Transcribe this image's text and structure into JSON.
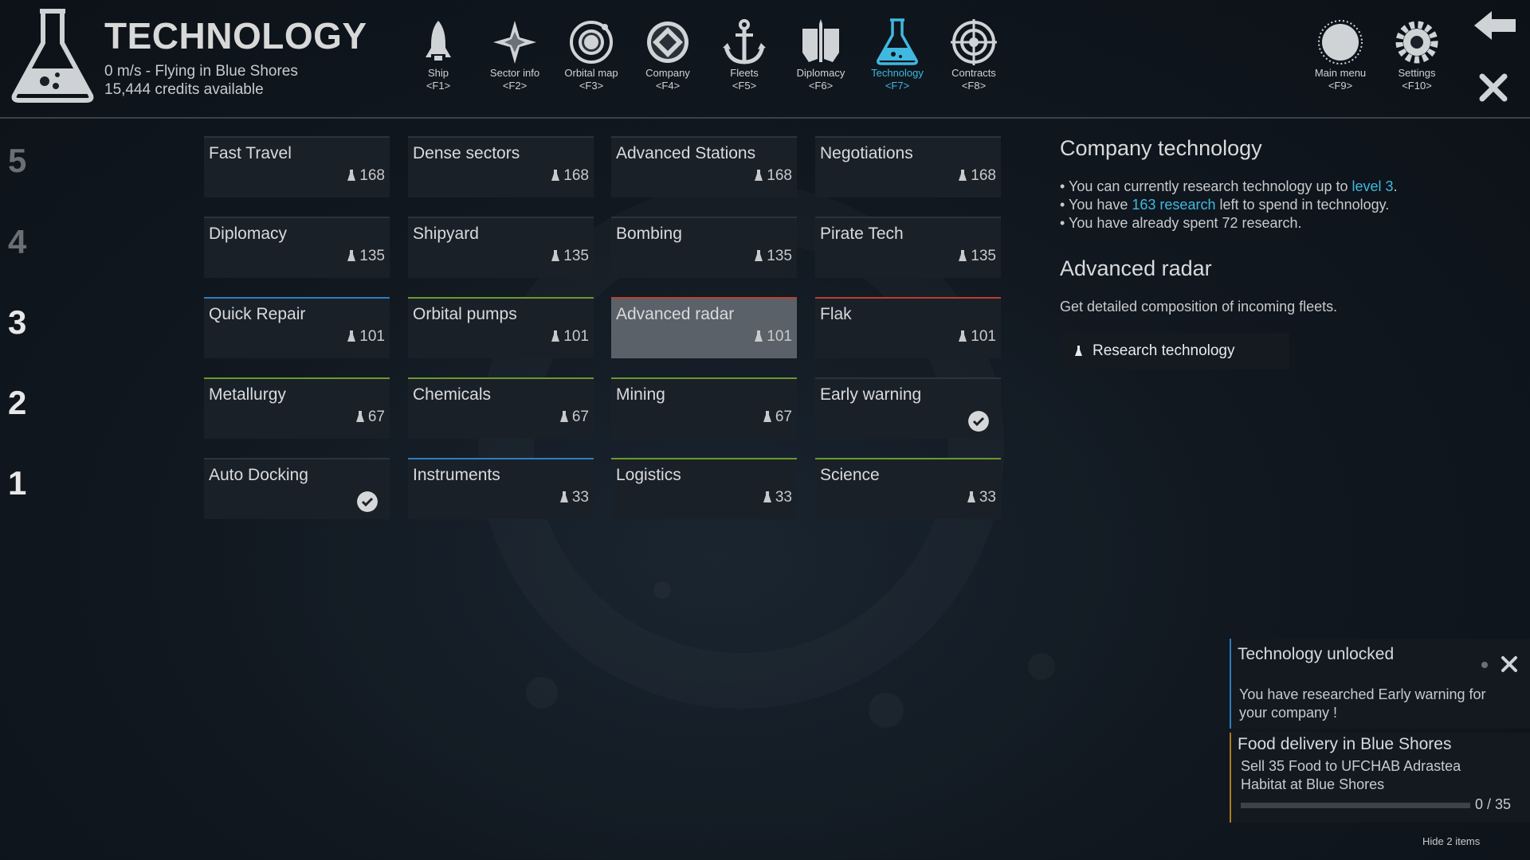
{
  "header": {
    "title": "TECHNOLOGY",
    "status_line": "0 m/s - Flying in Blue Shores",
    "credits_line": "15,444 credits available"
  },
  "nav": [
    {
      "label": "Ship",
      "key": "<F1>",
      "icon": "rocket-icon"
    },
    {
      "label": "Sector info",
      "key": "<F2>",
      "icon": "compass-star-icon"
    },
    {
      "label": "Orbital map",
      "key": "<F3>",
      "icon": "orbit-icon"
    },
    {
      "label": "Company",
      "key": "<F4>",
      "icon": "company-emblem-icon"
    },
    {
      "label": "Fleets",
      "key": "<F5>",
      "icon": "anchor-icon"
    },
    {
      "label": "Diplomacy",
      "key": "<F6>",
      "icon": "diplomacy-icon"
    },
    {
      "label": "Technology",
      "key": "<F7>",
      "icon": "flask-icon",
      "active": true
    },
    {
      "label": "Contracts",
      "key": "<F8>",
      "icon": "target-icon"
    },
    {
      "label": "Main menu",
      "key": "<F9>",
      "icon": "main-menu-icon"
    },
    {
      "label": "Settings",
      "key": "<F10>",
      "icon": "gear-icon"
    }
  ],
  "rows": [
    {
      "level": "5",
      "techs": [
        {
          "name": "Fast Travel",
          "cost": "168"
        },
        {
          "name": "Dense sectors",
          "cost": "168"
        },
        {
          "name": "Advanced Stations",
          "cost": "168"
        },
        {
          "name": "Negotiations",
          "cost": "168"
        }
      ]
    },
    {
      "level": "4",
      "techs": [
        {
          "name": "Diplomacy",
          "cost": "135"
        },
        {
          "name": "Shipyard",
          "cost": "135"
        },
        {
          "name": "Bombing",
          "cost": "135"
        },
        {
          "name": "Pirate Tech",
          "cost": "135"
        }
      ]
    },
    {
      "level": "3",
      "techs": [
        {
          "name": "Quick Repair",
          "cost": "101"
        },
        {
          "name": "Orbital pumps",
          "cost": "101"
        },
        {
          "name": "Advanced radar",
          "cost": "101"
        },
        {
          "name": "Flak",
          "cost": "101"
        }
      ]
    },
    {
      "level": "2",
      "techs": [
        {
          "name": "Metallurgy",
          "cost": "67"
        },
        {
          "name": "Chemicals",
          "cost": "67"
        },
        {
          "name": "Mining",
          "cost": "67"
        },
        {
          "name": "Early warning",
          "researched": true
        }
      ]
    },
    {
      "level": "1",
      "techs": [
        {
          "name": "Auto Docking",
          "researched": true
        },
        {
          "name": "Instruments",
          "cost": "33"
        },
        {
          "name": "Logistics",
          "cost": "33"
        },
        {
          "name": "Science",
          "cost": "33"
        }
      ]
    }
  ],
  "panel": {
    "heading": "Company technology",
    "line1_pre": "• You can currently research technology up to ",
    "line1_hl": "level 3",
    "line1_post": ".",
    "line2_pre": "• You have ",
    "line2_hl": "163 research",
    "line2_post": " left to spend in technology.",
    "line3": "• You have already spent 72 research.",
    "selected_name": "Advanced radar",
    "selected_desc": "Get detailed composition of incoming fleets.",
    "research_button": "Research technology"
  },
  "notifications": {
    "n1_title": "Technology unlocked",
    "n1_body_1": "You have researched Early warning for",
    "n1_body_2": "your company !",
    "n2_title": "Food delivery in Blue Shores",
    "n2_body_1": "Sell 35 Food to UFCHAB Adrastea",
    "n2_body_2": "Habitat at Blue Shores",
    "n2_progress_text": "0 / 35",
    "n2_progress_fraction": 0.0,
    "hide_label": "Hide 2 items"
  },
  "colors": {
    "accent": "#3fb9e0",
    "tier_blue": "#2c7fbf",
    "tier_green": "#6a9a2e",
    "tier_red": "#b8402e"
  }
}
